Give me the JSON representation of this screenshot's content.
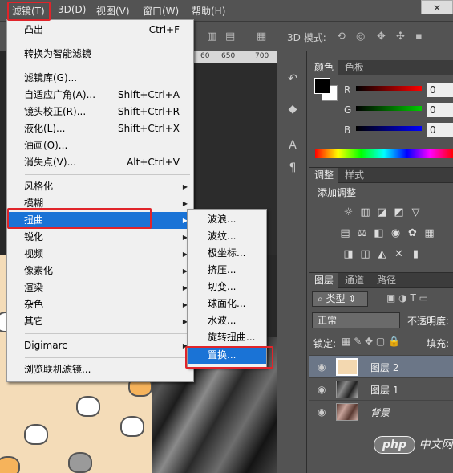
{
  "menubar": {
    "items": [
      "滤镜(T)",
      "3D(D)",
      "视图(V)",
      "窗口(W)",
      "帮助(H)"
    ],
    "close_label": "✕"
  },
  "optbar": {
    "mode_label": "3D 模式:"
  },
  "ruler": {
    "ticks": [
      "60",
      "650",
      "700"
    ]
  },
  "filter_menu": {
    "items": [
      {
        "label": "凸出",
        "shortcut": "Ctrl+F"
      },
      {
        "label": "转换为智能滤镜",
        "shortcut": ""
      },
      {
        "label": "滤镜库(G)...",
        "shortcut": ""
      },
      {
        "label": "自适应广角(A)...",
        "shortcut": "Shift+Ctrl+A"
      },
      {
        "label": "镜头校正(R)...",
        "shortcut": "Shift+Ctrl+R"
      },
      {
        "label": "液化(L)...",
        "shortcut": "Shift+Ctrl+X"
      },
      {
        "label": "油画(O)...",
        "shortcut": ""
      },
      {
        "label": "消失点(V)...",
        "shortcut": "Alt+Ctrl+V"
      },
      {
        "label": "风格化",
        "shortcut": ""
      },
      {
        "label": "模糊",
        "shortcut": ""
      },
      {
        "label": "扭曲",
        "shortcut": ""
      },
      {
        "label": "锐化",
        "shortcut": ""
      },
      {
        "label": "视频",
        "shortcut": ""
      },
      {
        "label": "像素化",
        "shortcut": ""
      },
      {
        "label": "渲染",
        "shortcut": ""
      },
      {
        "label": "杂色",
        "shortcut": ""
      },
      {
        "label": "其它",
        "shortcut": ""
      },
      {
        "label": "Digimarc",
        "shortcut": ""
      },
      {
        "label": "浏览联机滤镜...",
        "shortcut": ""
      }
    ]
  },
  "distort_submenu": {
    "items": [
      "波浪...",
      "波纹...",
      "极坐标...",
      "挤压...",
      "切变...",
      "球面化...",
      "水波...",
      "旋转扭曲...",
      "置换..."
    ]
  },
  "color_panel": {
    "tabs": [
      "颜色",
      "色板"
    ],
    "channels": [
      {
        "label": "R",
        "value": "0",
        "color": "#ff0000"
      },
      {
        "label": "G",
        "value": "0",
        "color": "#00c000"
      },
      {
        "label": "B",
        "value": "0",
        "color": "#0000ff"
      }
    ]
  },
  "adjust_panel": {
    "tabs": [
      "调整",
      "样式"
    ],
    "title": "添加调整"
  },
  "layers_panel": {
    "tabs": [
      "图层",
      "通道",
      "路径"
    ],
    "filter_kind": "类型",
    "blend_mode": "正常",
    "opacity_label": "不透明度:",
    "lock_label": "锁定:",
    "fill_label": "填充:",
    "layers": [
      {
        "name": "图层 2",
        "selected": true
      },
      {
        "name": "图层 1",
        "selected": false
      },
      {
        "name": "背景",
        "selected": false
      }
    ]
  },
  "watermark": "php",
  "watermark_suffix": "中文网"
}
